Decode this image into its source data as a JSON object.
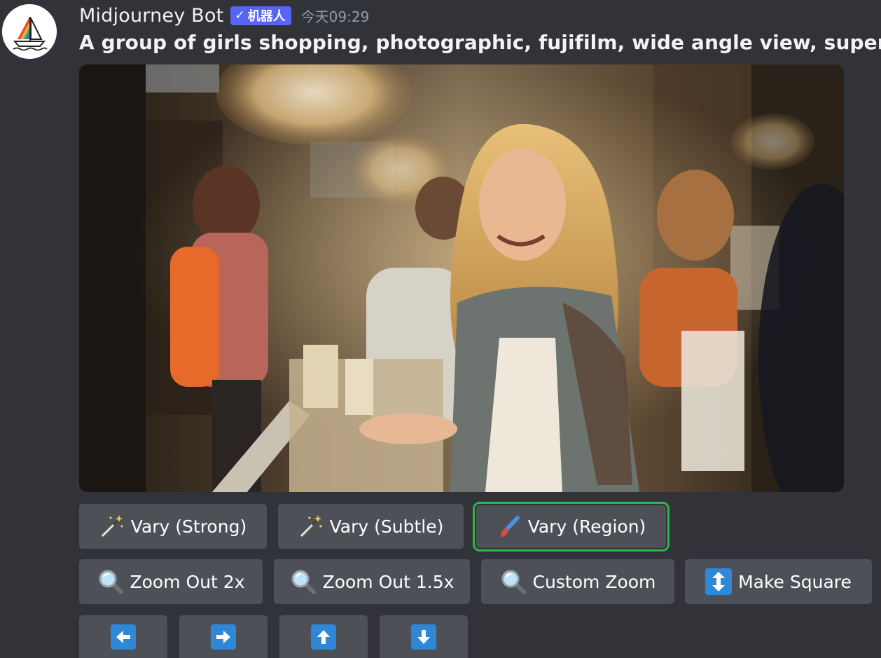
{
  "message": {
    "username": "Midjourney Bot",
    "bot_badge": {
      "check": "✓",
      "label": "机器人",
      "color": "#5865f2"
    },
    "timestamp": "今天09:29",
    "prompt": "A group of girls shopping, photographic, fujifilm, wide angle view, super detailed, s"
  },
  "image": {
    "description_icon": "shopping-photo"
  },
  "buttons": {
    "row1": [
      {
        "label": "Vary (Strong)",
        "icon": "magic-wand-icon"
      },
      {
        "label": "Vary (Subtle)",
        "icon": "magic-wand-icon"
      },
      {
        "label": "Vary (Region)",
        "icon": "paintbrush-icon",
        "selected": true
      }
    ],
    "row2": [
      {
        "label": "Zoom Out 2x",
        "icon": "magnifier-icon"
      },
      {
        "label": "Zoom Out 1.5x",
        "icon": "magnifier-icon"
      },
      {
        "label": "Custom Zoom",
        "icon": "magnifier-icon"
      },
      {
        "label": "Make Square",
        "icon": "up-down-arrow-icon"
      }
    ],
    "row3": [
      {
        "icon": "arrow-left-icon"
      },
      {
        "icon": "arrow-right-icon"
      },
      {
        "icon": "arrow-up-icon"
      },
      {
        "icon": "arrow-down-icon"
      }
    ]
  },
  "colors": {
    "background": "#313338",
    "button": "#4e5058",
    "selected_outline": "#2fb54a",
    "arrow_icon": "#2e88d6"
  }
}
